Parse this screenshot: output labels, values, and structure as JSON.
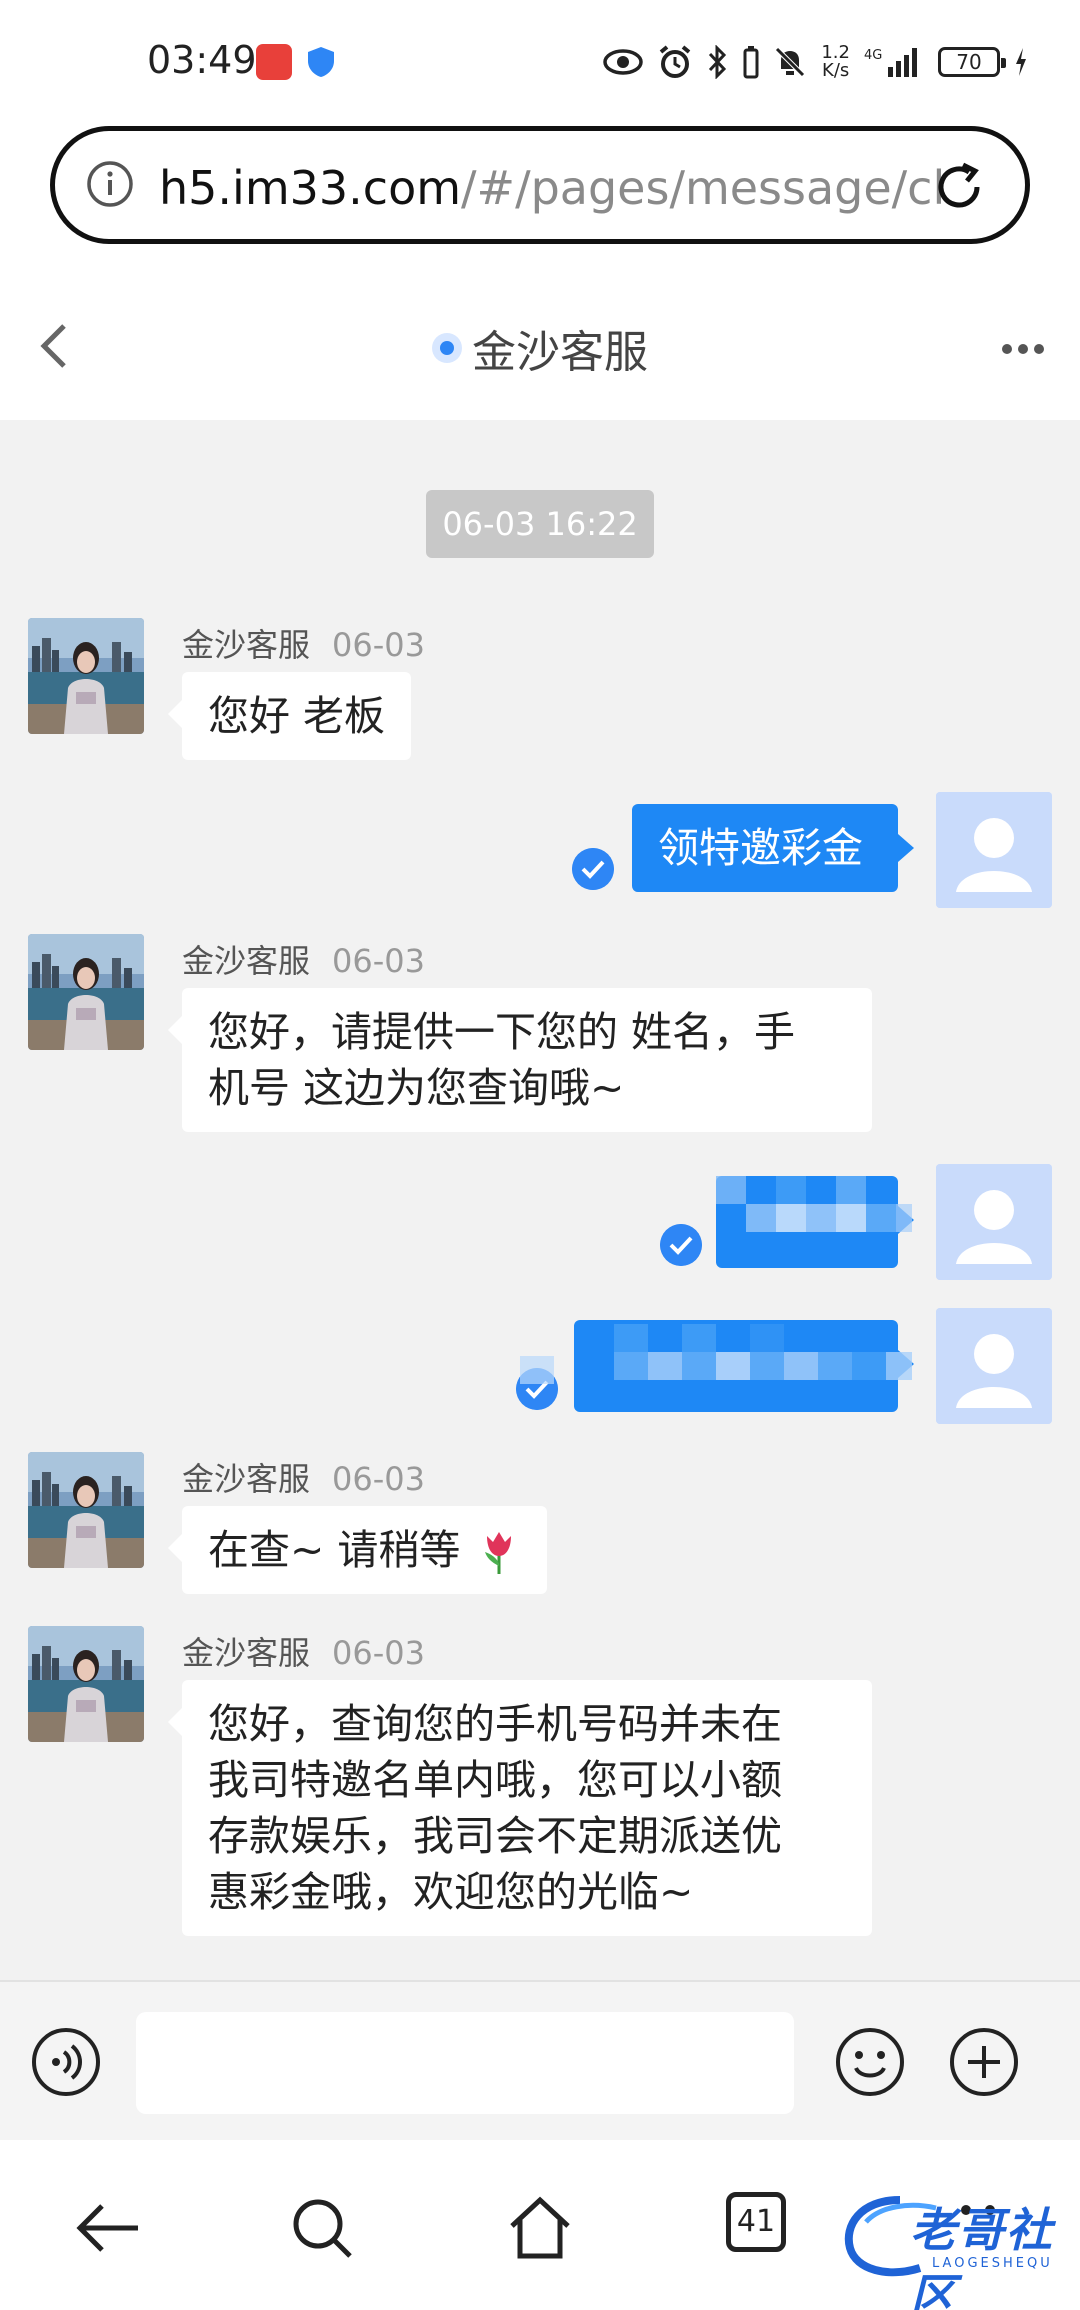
{
  "status_bar": {
    "time": "03:49",
    "network_speed_top": "1.2",
    "network_speed_bottom": "K/s",
    "network_type": "4G",
    "battery": "70"
  },
  "browser": {
    "url_main": "h5.im33.com",
    "url_rest": "/#/pages/message/cl"
  },
  "chat": {
    "title": "金沙客服",
    "timestamp": "06-03 16:22",
    "messages": [
      {
        "side": "left",
        "sender": "金沙客服",
        "date": "06-03",
        "text": "您好 老板"
      },
      {
        "side": "right",
        "text": "领特邀彩金"
      },
      {
        "side": "left",
        "sender": "金沙客服",
        "date": "06-03",
        "text_line1": "您好，请提供一下您的 姓名，手",
        "text_line2": "机号 这边为您查询哦~"
      },
      {
        "side": "right",
        "text": ""
      },
      {
        "side": "right",
        "text": ""
      },
      {
        "side": "left",
        "sender": "金沙客服",
        "date": "06-03",
        "text": "在查~ 请稍等"
      },
      {
        "side": "left",
        "sender": "金沙客服",
        "date": "06-03",
        "text_line1": "您好，查询您的手机号码并未在",
        "text_line2": "我司特邀名单内哦，您可以小额",
        "text_line3": "存款娱乐，我司会不定期派送优",
        "text_line4": "惠彩金哦，欢迎您的光临~"
      }
    ]
  },
  "input": {
    "value": ""
  },
  "bottom_nav": {
    "tab_count": "41"
  },
  "watermark": {
    "text": "老哥社区",
    "sub": "LAOGESHEQU"
  },
  "colors": {
    "accent": "#1e88f5",
    "bubble_left": "#ffffff",
    "chat_bg": "#f2f2f2"
  }
}
